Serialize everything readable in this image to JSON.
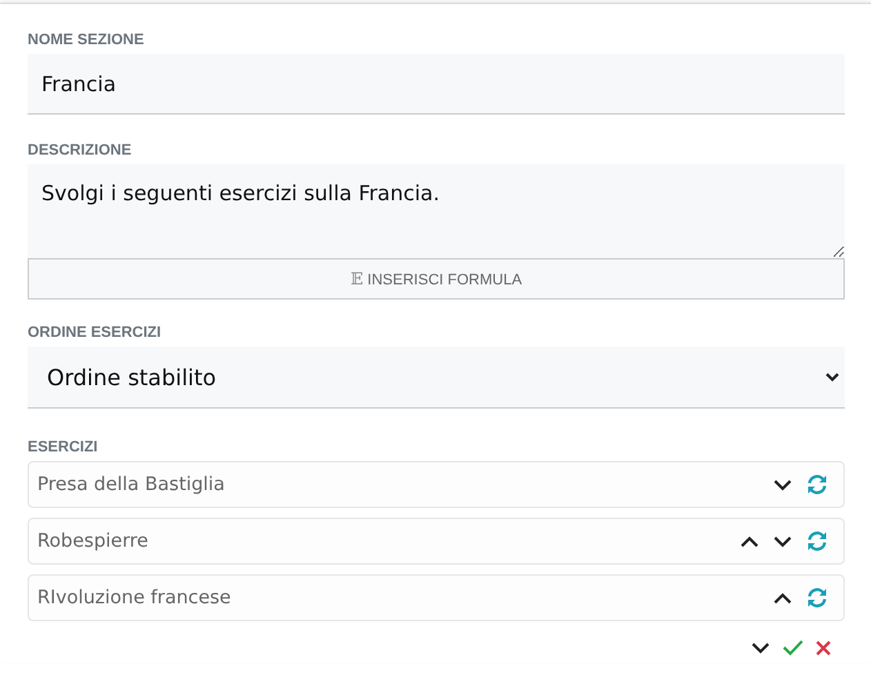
{
  "section_name": {
    "label": "NOME SEZIONE",
    "value": "Francia"
  },
  "description": {
    "label": "DESCRIZIONE",
    "value": "Svolgi i seguenti esercizi sulla Francia.",
    "formula_button": {
      "icon": "𝔼",
      "label": "INSERISCI FORMULA"
    }
  },
  "order": {
    "label": "ORDINE ESERCIZI",
    "value": "Ordine stabilito"
  },
  "exercises": {
    "label": "ESERCIZI",
    "items": [
      {
        "title": "Presa della Bastiglia",
        "can_move_up": false,
        "can_move_down": true
      },
      {
        "title": "Robespierre",
        "can_move_up": true,
        "can_move_down": true
      },
      {
        "title": "RIvoluzione francese",
        "can_move_up": true,
        "can_move_down": false
      }
    ]
  }
}
